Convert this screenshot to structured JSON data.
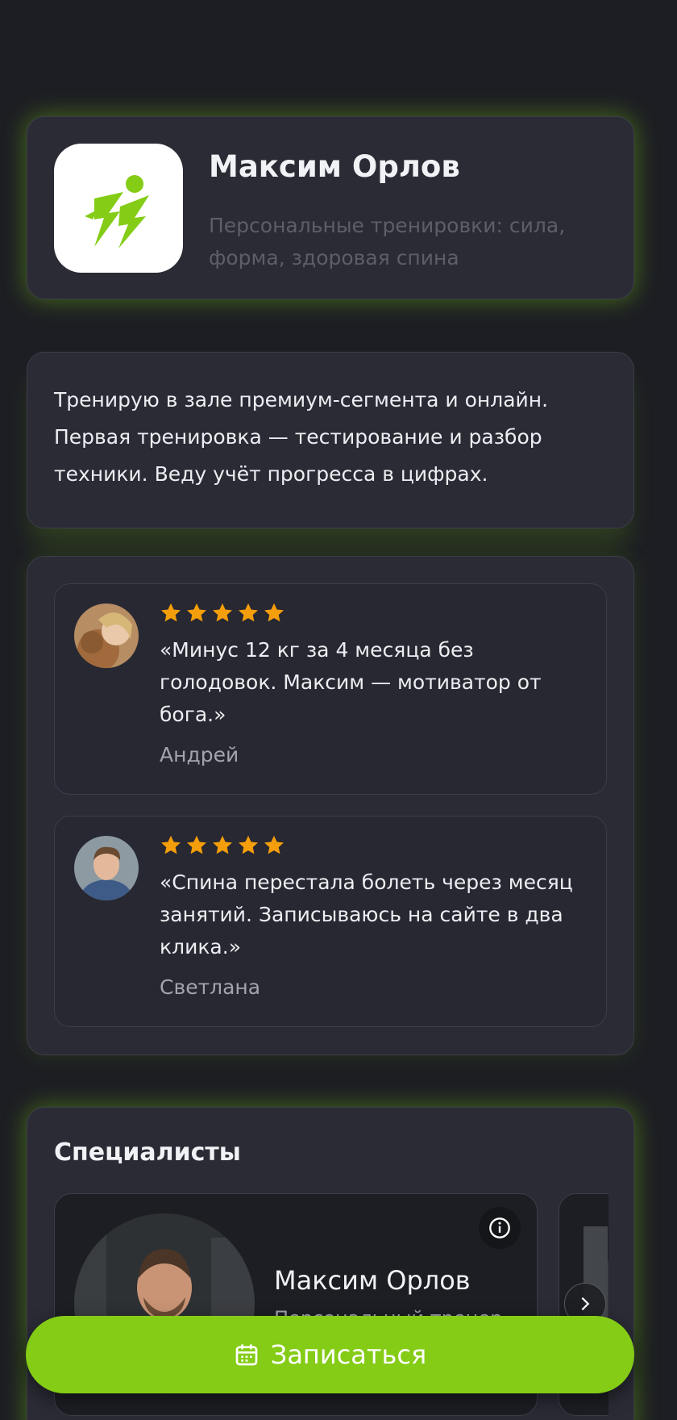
{
  "profile": {
    "name": "Максим Орлов",
    "subtitle": "Персональные тренировки: сила, форма, здоровая спина",
    "logo_icon": "running-lightning-icon"
  },
  "about": {
    "text": "Тренирую в зале премиум-сегмента и онлайн. Первая тренировка — тестирование и разбор техники. Веду учёт прогресса в цифрах."
  },
  "reviews": [
    {
      "rating": 5,
      "text": "«Минус 12 кг за 4 месяца без голодовок. Максим — мотиватор от бога.»",
      "author": "Андрей"
    },
    {
      "rating": 5,
      "text": "«Спина перестала болеть через месяц занятий. Записываюсь на сайте в два клика.»",
      "author": "Светлана"
    }
  ],
  "specialists": {
    "title": "Специалисты",
    "items": [
      {
        "name": "Максим Орлов",
        "role": "Персональный тренер"
      }
    ]
  },
  "cta": {
    "label": "Записаться",
    "icon": "calendar-icon"
  },
  "colors": {
    "accent": "#84cc16",
    "star": "#f59e0b",
    "card_bg": "#2a2b34",
    "page_bg": "#1d1e23"
  }
}
